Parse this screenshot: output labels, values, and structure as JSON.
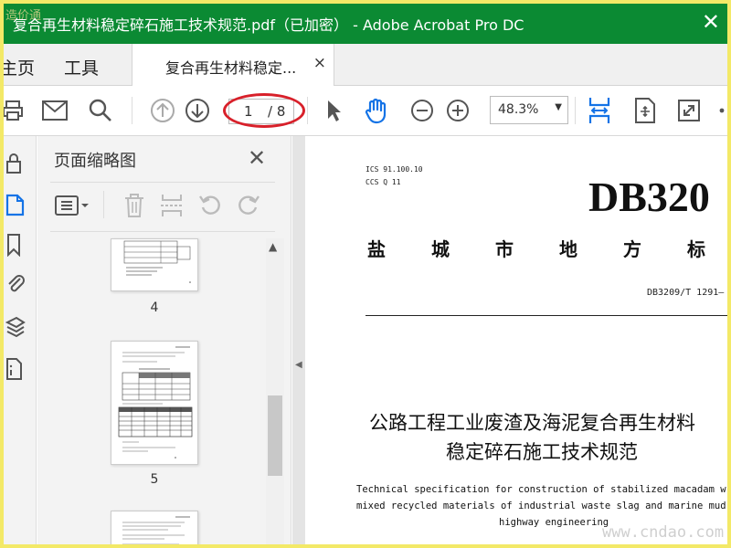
{
  "titlebar": {
    "corner_mark": "造价通",
    "title": "复合再生材料稳定碎石施工技术规范.pdf（已加密） - Adobe Acrobat Pro DC",
    "close_glyph": "✕"
  },
  "nav": {
    "home_label": "主页",
    "tools_label": "工具"
  },
  "tab": {
    "label": "复合再生材料稳定...",
    "close_glyph": "×"
  },
  "toolbar": {
    "page_current": "1",
    "page_total": "/ 8",
    "zoom": "48.3%",
    "zoom_caret": "▼"
  },
  "panel": {
    "title": "页面缩略图",
    "close_glyph": "✕",
    "scroll_up_glyph": "▲",
    "collapse_glyph": "◀",
    "thumbnails": [
      {
        "page": "4"
      },
      {
        "page": "5"
      }
    ]
  },
  "document": {
    "ics_line1": "ICS 91.100.10",
    "ics_line2": "CCS Q 11",
    "db_code": "DB320",
    "region_chars": [
      "盐",
      "城",
      "市",
      "地",
      "方",
      "标"
    ],
    "std_number": "DB3209/T 1291—",
    "title_cn_line1": "公路工程工业废渣及海泥复合再生材料",
    "title_cn_line2": "稳定碎石施工技术规范",
    "title_en_line1": "Technical specification for construction of stabilized macadam w",
    "title_en_line2": "mixed recycled materials of industrial waste slag and marine mud",
    "title_en_line3": "highway engineering"
  },
  "watermark": "www.cndao.com",
  "colors": {
    "titlebar_green": "#0b8a33",
    "accent_blue": "#1473e6",
    "annotation_red": "#d8202a",
    "frame_yellow": "#f3e967"
  }
}
